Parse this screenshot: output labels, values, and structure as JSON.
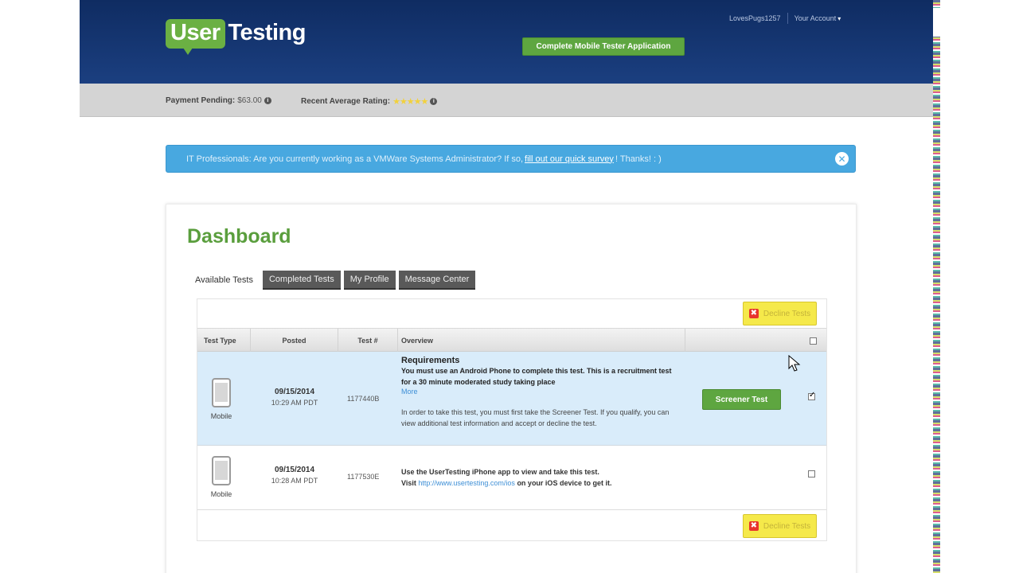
{
  "header": {
    "logo_left": "User",
    "logo_right": "Testing",
    "username": "LovesPugs1257",
    "account_label": "Your Account",
    "cta_label": "Complete Mobile Tester Application"
  },
  "strip": {
    "payment_label": "Payment Pending:",
    "payment_value": "$63.00",
    "rating_label": "Recent Average Rating:",
    "rating_stars": "★★★★★",
    "rating_value": 4.5
  },
  "alert": {
    "text_before": "IT Professionals: Are you currently working as a VMWare Systems Administrator? If so,",
    "link_text": "fill out our quick survey",
    "text_after": "! Thanks! : )",
    "close_glyph": "✕"
  },
  "dashboard": {
    "title": "Dashboard",
    "tabs": {
      "available": "Available Tests",
      "completed": "Completed Tests",
      "profile": "My Profile",
      "messages": "Message Center"
    },
    "decline_label": "Decline Tests",
    "columns": {
      "type": "Test Type",
      "posted": "Posted",
      "testnum": "Test #",
      "overview": "Overview"
    },
    "rows": [
      {
        "type": "Mobile",
        "date": "09/15/2014",
        "time": "10:29 AM PDT",
        "testnum": "1177440B",
        "req_title": "Requirements",
        "req_text": "You must use an Android Phone to complete this test. This is a recruitment test for a 30 minute moderated study taking place",
        "more": "More",
        "note": "In order to take this test, you must first take the Screener Test. If you qualify, you can view additional test information and accept or decline the test.",
        "button": "Screener Test",
        "checked": true
      },
      {
        "type": "Mobile",
        "date": "09/15/2014",
        "time": "10:28 AM PDT",
        "testnum": "1177530E",
        "line1": "Use the UserTesting iPhone app to view and take this test.",
        "line2_before": "Visit",
        "line2_link": "http://www.usertesting.com/ios",
        "line2_after": "on your iOS device to get it.",
        "checked": false
      }
    ]
  },
  "colors": {
    "header_dark": "#0f2c62",
    "brand_green": "#6bb043",
    "alert_blue": "#48a8e0",
    "title_green": "#5a9e3d",
    "decline_yellow": "#f5e94a",
    "selected_row": "#d9ecfa"
  }
}
